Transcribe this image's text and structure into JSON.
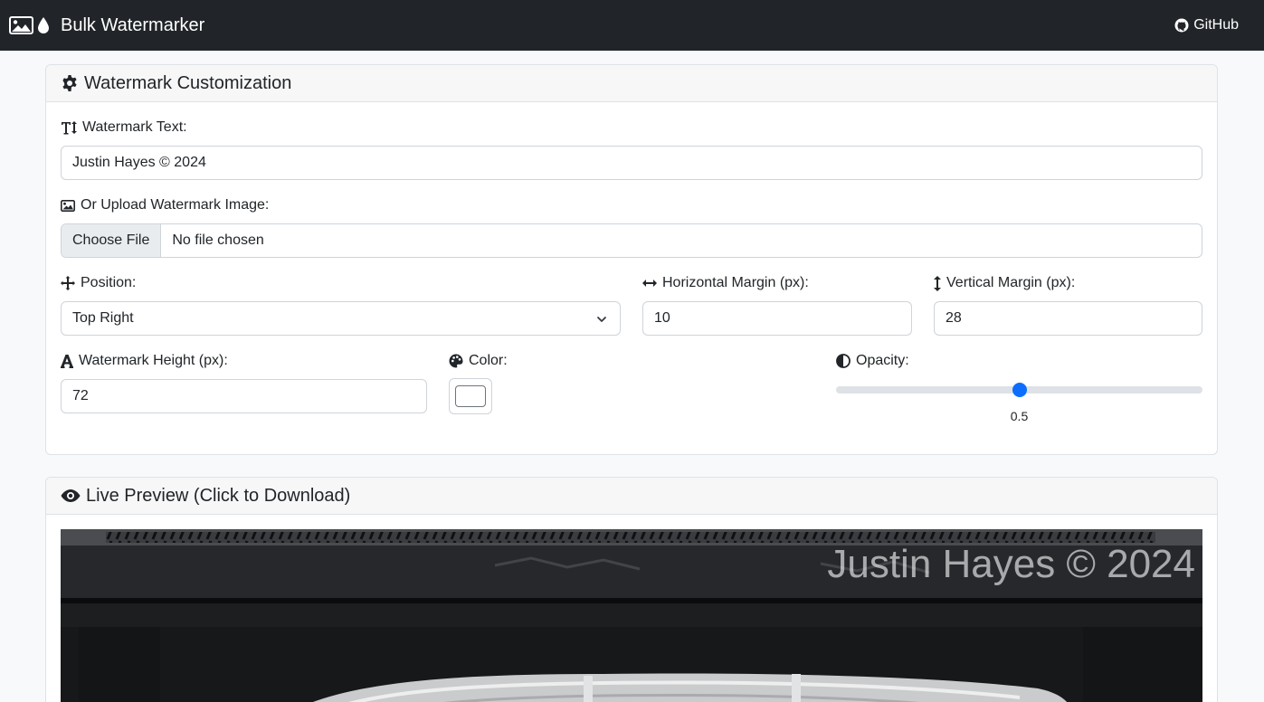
{
  "app": {
    "title": "Bulk Watermarker",
    "nav_github": "GitHub"
  },
  "customization": {
    "header": "Watermark Customization",
    "watermark_text_label": "Watermark Text:",
    "watermark_text_value": "Justin Hayes © 2024",
    "upload_label": "Or Upload Watermark Image:",
    "choose_file": "Choose File",
    "no_file": "No file chosen",
    "position_label": "Position:",
    "position_value": "Top Right",
    "h_margin_label": "Horizontal Margin (px):",
    "h_margin_value": "10",
    "v_margin_label": "Vertical Margin (px):",
    "v_margin_value": "28",
    "height_label": "Watermark Height (px):",
    "height_value": "72",
    "color_label": "Color:",
    "color_value": "#ffffff",
    "opacity_label": "Opacity:",
    "opacity_value": "0.5",
    "opacity_fraction": 0.5
  },
  "preview": {
    "header": "Live Preview (Click to Download)",
    "watermark_text": "Justin Hayes © 2024"
  },
  "colors": {
    "navbar": "#212529",
    "accent": "#0d6efd"
  }
}
